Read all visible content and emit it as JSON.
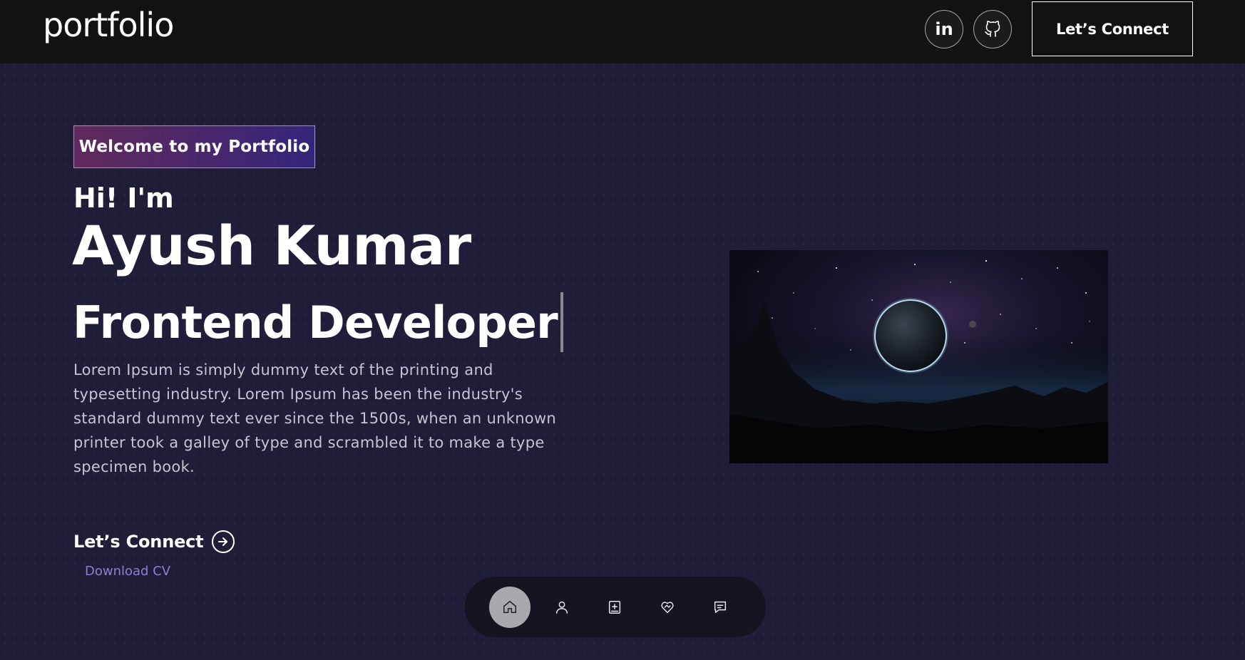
{
  "header": {
    "logo": "portfolio",
    "social": [
      {
        "name": "linkedin",
        "icon": "linkedin-icon",
        "label": "in"
      },
      {
        "name": "github",
        "icon": "github-icon"
      }
    ],
    "cta_label": "Let’s Connect"
  },
  "hero": {
    "badge": "Welcome to my Portfolio",
    "greeting": "Hi! I'm",
    "name": "Ayush Kumar",
    "role": "Frontend Developer",
    "description": "Lorem Ipsum is simply dummy text of the printing and typesetting industry. Lorem Ipsum has been the industry's standard dummy text ever since the 1500s, when an unknown printer took a galley of type and scrambled it to make a type specimen book.",
    "cta_label": "Let’s Connect",
    "download_label": "Download CV"
  },
  "bottom_nav": {
    "items": [
      {
        "icon": "home-icon",
        "active": true
      },
      {
        "icon": "user-icon",
        "active": false
      },
      {
        "icon": "add-document-icon",
        "active": false
      },
      {
        "icon": "heart-handshake-icon",
        "active": false
      },
      {
        "icon": "message-icon",
        "active": false
      }
    ]
  },
  "colors": {
    "background": "#1f1d38",
    "header": "#121212",
    "badge_gradient_start": "#aa367c",
    "badge_gradient_end": "#4a2fbd",
    "download_link": "#8c7fd1",
    "nav_background": "#151420"
  }
}
